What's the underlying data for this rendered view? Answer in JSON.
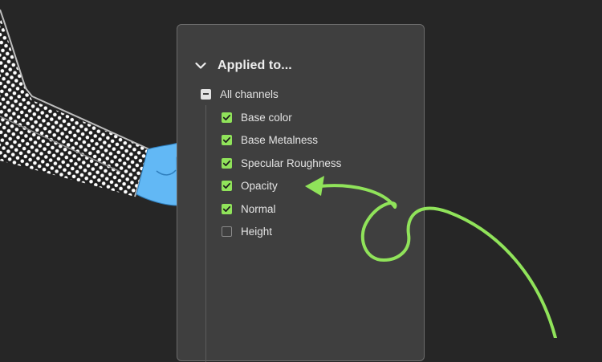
{
  "panel": {
    "title": "Applied to...",
    "parent": {
      "label": "All channels",
      "state": "indeterminate"
    },
    "channels": [
      {
        "label": "Base color",
        "checked": true
      },
      {
        "label": "Base Metalness",
        "checked": true
      },
      {
        "label": "Specular Roughness",
        "checked": true
      },
      {
        "label": "Opacity",
        "checked": true
      },
      {
        "label": "Normal",
        "checked": true
      },
      {
        "label": "Height",
        "checked": false
      }
    ]
  },
  "colors": {
    "background": "#262626",
    "panel": "#3f3f3f",
    "accent_green": "#90e35a",
    "hand_blue": "#62b8f5",
    "sleeve_dark": "#1f1f1f"
  },
  "icons": {
    "header": "chevron-down-icon",
    "check": "checkmark-icon",
    "parent": "minus-icon"
  }
}
